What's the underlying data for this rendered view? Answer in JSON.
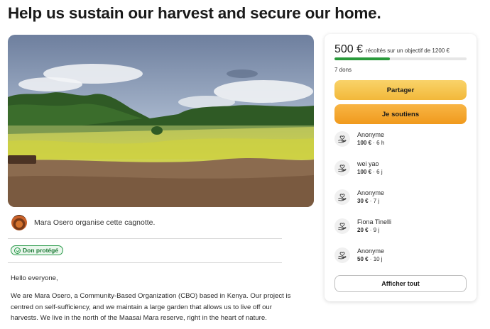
{
  "page": {
    "title": "Help us sustain our harvest and secure our home."
  },
  "organizer": {
    "text": "Mara Osero organise cette cagnotte."
  },
  "badge": {
    "label": "Don protégé"
  },
  "story": {
    "greeting": "Hello everyone,",
    "paragraph": "We are Mara Osero, a Community-Based Organization (CBO) based in Kenya. Our project is centred on self-sufficiency, and we maintain a large garden that allows us to live off our harvests. We live in the north of the Maasai Mara reserve, right in the heart of nature."
  },
  "sidebar": {
    "amount": "500 €",
    "goal_text": "récoltés sur un objectif de 1200 €",
    "progress_fraction": 0.42,
    "donations_count": "7 dons",
    "share_label": "Partager",
    "support_label": "Je soutiens",
    "show_all_label": "Afficher tout",
    "donors": [
      {
        "name": "Anonyme",
        "amount": "100 €",
        "time": " · 6 h"
      },
      {
        "name": "wei yao",
        "amount": "100 €",
        "time": " · 6 j"
      },
      {
        "name": "Anonyme",
        "amount": "30 €",
        "time": " · 7 j"
      },
      {
        "name": "Fiona Tinelli",
        "amount": "20 €",
        "time": " · 9 j"
      },
      {
        "name": "Anonyme",
        "amount": "50 €",
        "time": " · 10 j"
      }
    ]
  },
  "icons": {
    "donor": "heart-hand-icon",
    "badge": "shield-check-icon"
  },
  "colors": {
    "progress": "#2a9a3b",
    "primary_button": "#f09a1d",
    "secondary_button": "#f2b83a",
    "protected": "#2b9a4b"
  }
}
